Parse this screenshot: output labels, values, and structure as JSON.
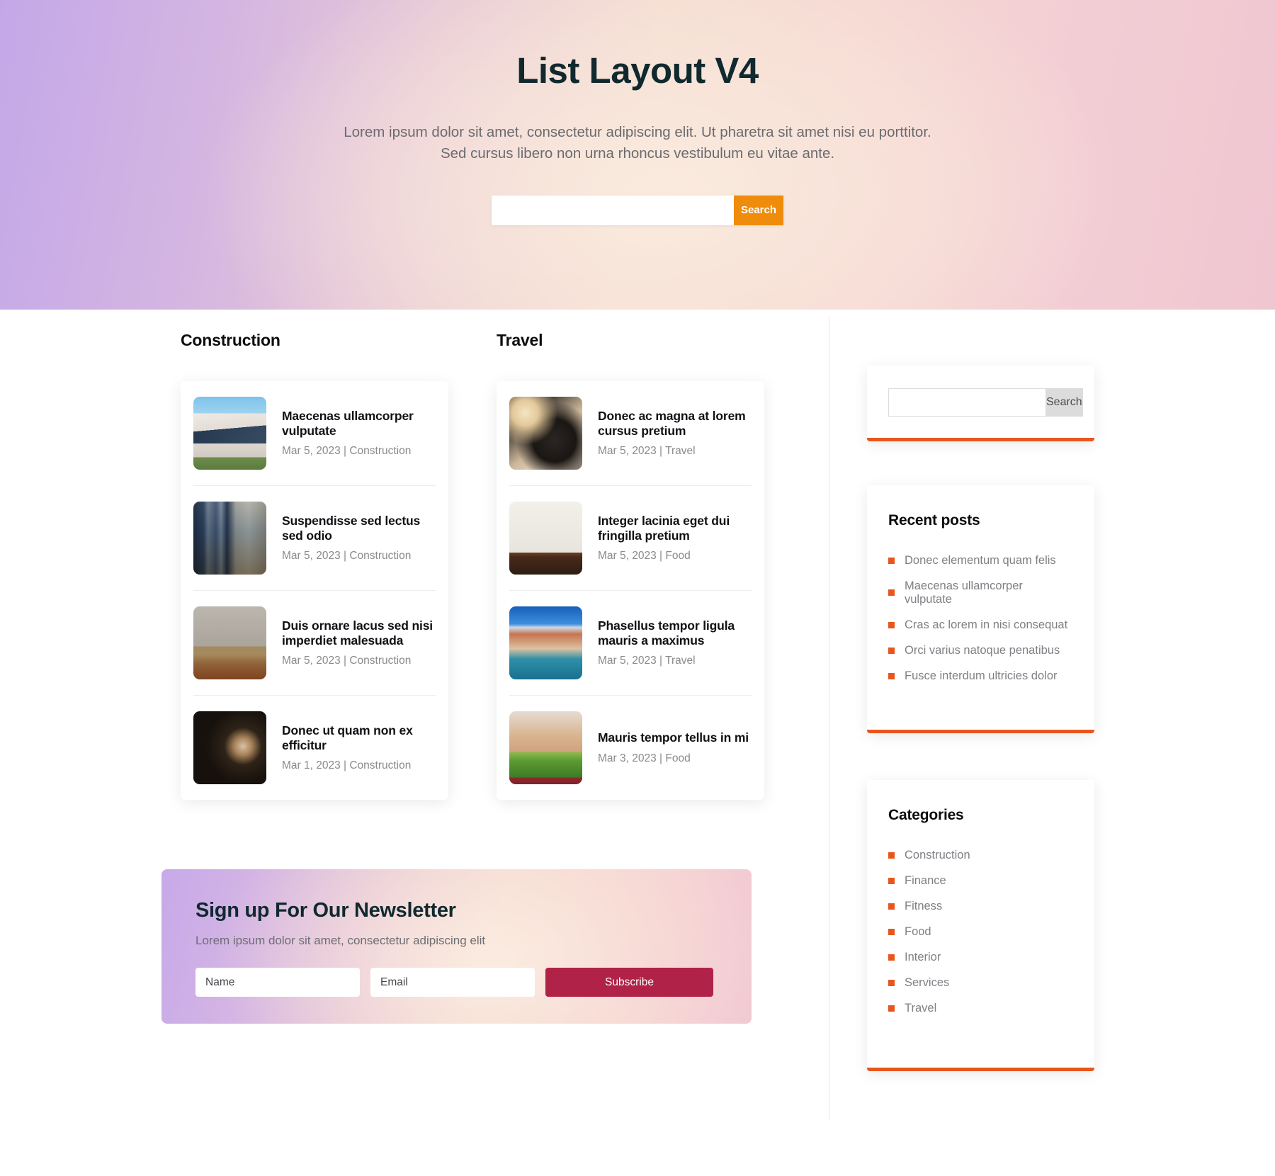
{
  "hero": {
    "title": "List Layout V4",
    "subtitle": "Lorem ipsum dolor sit amet, consectetur adipiscing elit. Ut pharetra sit amet nisi eu porttitor. Sed cursus libero non urna rhoncus vestibulum eu vitae ante.",
    "search_value": "",
    "search_placeholder": "",
    "search_button": "Search"
  },
  "columns": [
    {
      "title": "Construction",
      "posts": [
        {
          "title": "Maecenas ullamcorper vulputate",
          "date": "Mar 5, 2023",
          "category": "Construction",
          "meta": "Mar 5, 2023 | Construction",
          "thumb": "img-house"
        },
        {
          "title": "Suspendisse sed lectus sed odio",
          "date": "Mar 5, 2023",
          "category": "Construction",
          "meta": "Mar 5, 2023 | Construction",
          "thumb": "img-city"
        },
        {
          "title": "Duis ornare lacus sed nisi imperdiet malesuada",
          "date": "Mar 5, 2023",
          "category": "Construction",
          "meta": "Mar 5, 2023 | Construction",
          "thumb": "img-crane"
        },
        {
          "title": "Donec ut quam non ex efficitur",
          "date": "Mar 1, 2023",
          "category": "Construction",
          "meta": "Mar 1, 2023 | Construction",
          "thumb": "img-leather"
        }
      ]
    },
    {
      "title": "Travel",
      "posts": [
        {
          "title": "Donec ac magna at lorem cursus pretium",
          "date": "Mar 5, 2023",
          "category": "Travel",
          "meta": "Mar 5, 2023 | Travel",
          "thumb": "img-driving"
        },
        {
          "title": "Integer lacinia eget dui fringilla pretium",
          "date": "Mar 5, 2023",
          "category": "Food",
          "meta": "Mar 5, 2023 | Food",
          "thumb": "img-choco"
        },
        {
          "title": "Phasellus tempor ligula mauris a maximus",
          "date": "Mar 5, 2023",
          "category": "Travel",
          "meta": "Mar 5, 2023 | Travel",
          "thumb": "img-venice"
        },
        {
          "title": "Mauris tempor tellus in mi",
          "date": "Mar 3, 2023",
          "category": "Food",
          "meta": "Mar 3, 2023 | Food",
          "thumb": "img-veg"
        }
      ]
    }
  ],
  "newsletter": {
    "title": "Sign up For Our Newsletter",
    "subtitle": "Lorem ipsum dolor sit amet, consectetur adipiscing elit",
    "name_value": "",
    "name_placeholder": "Name",
    "email_value": "",
    "email_placeholder": "Email",
    "button": "Subscribe"
  },
  "sidebar": {
    "search": {
      "value": "",
      "placeholder": "",
      "button": "Search"
    },
    "recent_posts": {
      "title": "Recent posts",
      "items": [
        "Donec elementum quam felis",
        "Maecenas ullamcorper vulputate",
        "Cras ac lorem in nisi consequat",
        "Orci varius natoque penatibus",
        "Fusce interdum ultricies dolor"
      ]
    },
    "categories": {
      "title": "Categories",
      "items": [
        "Construction",
        "Finance",
        "Fitness",
        "Food",
        "Interior",
        "Services",
        "Travel"
      ]
    }
  },
  "colors": {
    "accent_orange": "#e8561e",
    "hero_button_orange": "#f08c0c",
    "subscribe_crimson": "#b12248",
    "heading_dark": "#10292e",
    "muted_text": "#7f7f85"
  }
}
